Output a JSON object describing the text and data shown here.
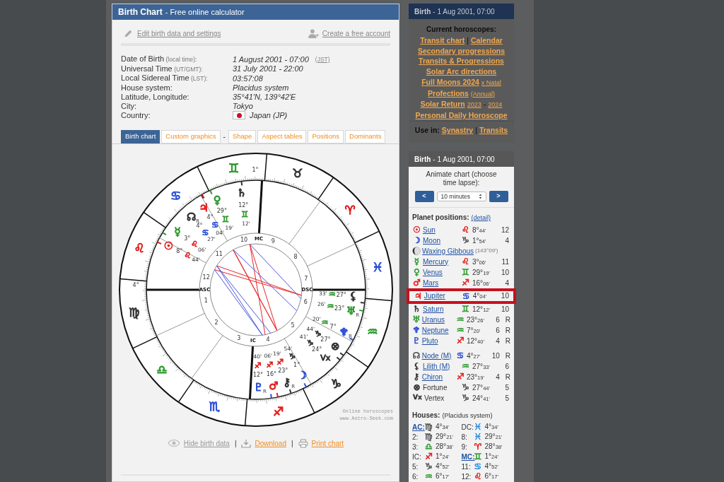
{
  "main_panel": {
    "title": "Birth Chart",
    "subtitle": "- Free online calculator",
    "edit_link": "Edit birth data and settings",
    "account_link": "Create a free account",
    "info": [
      {
        "label": "Date of Birth",
        "note": "(local time):",
        "value": "1 August 2001 - 07:00",
        "extra": "(JST)"
      },
      {
        "label": "Universal Time",
        "note": "(UT/GMT):",
        "value": "31 July 2001 - 22:00"
      },
      {
        "label": "Local Sidereal Time",
        "note": "(LST):",
        "value": "03:57:08"
      },
      {
        "label": "House system:",
        "value": "Placidus system"
      },
      {
        "label": "Latitude, Longitude:",
        "value": "35°41'N, 139°42'E"
      },
      {
        "label": "City:",
        "value": "Tokyo"
      },
      {
        "label": "Country:",
        "value": "Japan (JP)",
        "flag": true
      }
    ],
    "tabs": [
      {
        "kind": "tab",
        "label": "Birth chart",
        "selected": true
      },
      {
        "kind": "tab",
        "label": "Custom graphics",
        "selected": false
      },
      {
        "kind": "separator",
        "label": "-"
      },
      {
        "kind": "tab",
        "label": "Shape",
        "selected": false
      },
      {
        "kind": "tab",
        "label": "Aspect tables",
        "selected": false
      },
      {
        "kind": "tab",
        "label": "Positions",
        "selected": false
      },
      {
        "kind": "tab",
        "label": "Dominants",
        "selected": false
      }
    ],
    "chart": {
      "signs": [
        {
          "glyph": "♈︎",
          "color": "#e0201e"
        },
        {
          "glyph": "♉︎",
          "color": "#333333"
        },
        {
          "glyph": "♊︎",
          "color": "#2e9a2e"
        },
        {
          "glyph": "♋︎",
          "color": "#2c4fd6"
        },
        {
          "glyph": "♌︎",
          "color": "#e0201e"
        },
        {
          "glyph": "♍︎",
          "color": "#333333"
        },
        {
          "glyph": "♎︎",
          "color": "#2e9a2e"
        },
        {
          "glyph": "♏︎",
          "color": "#2c4fd6"
        },
        {
          "glyph": "♐︎",
          "color": "#e0201e"
        },
        {
          "glyph": "♑︎",
          "color": "#333333"
        },
        {
          "glyph": "♒︎",
          "color": "#2e9a2e"
        },
        {
          "glyph": "♓︎",
          "color": "#2c4fd6"
        }
      ],
      "houses": [
        "1",
        "2",
        "3",
        "4",
        "5",
        "6",
        "7",
        "8",
        "9",
        "10",
        "11",
        "12"
      ],
      "angles": [
        "ASC",
        "IC",
        "DSC",
        "MC"
      ],
      "angle_degrees": [
        "4°",
        "1°"
      ],
      "planets": [
        {
          "glyph": "☉",
          "color": "#e0201e",
          "degree": "8°",
          "sign": {
            "glyph": "♌︎",
            "color": "#e0201e"
          },
          "minute": "44'"
        },
        {
          "glyph": "☿",
          "color": "#2e9a2e",
          "degree": "3°",
          "sign": {
            "glyph": "♌︎",
            "color": "#e0201e"
          },
          "minute": "06'"
        },
        {
          "glyph": "☊",
          "color": "#333333",
          "retro": "R",
          "degree": "4°",
          "sign": {
            "glyph": "♋︎",
            "color": "#2c4fd6"
          },
          "minute": "27'"
        },
        {
          "glyph": "♃",
          "color": "#e0201e",
          "degree": "4°",
          "sign": {
            "glyph": "♋︎",
            "color": "#2c4fd6"
          },
          "minute": "04'"
        },
        {
          "glyph": "♀",
          "color": "#2e9a2e",
          "degree": "29°",
          "sign": {
            "glyph": "♊︎",
            "color": "#2e9a2e"
          },
          "minute": "19'"
        },
        {
          "glyph": "♄",
          "color": "#333333",
          "degree": "12°",
          "sign": {
            "glyph": "♊︎",
            "color": "#2e9a2e"
          },
          "minute": "12'"
        },
        {
          "glyph": "⚸",
          "color": "#333333",
          "degree": "27°",
          "sign": {
            "glyph": "♒︎",
            "color": "#2e9a2e"
          },
          "minute": "33'"
        },
        {
          "glyph": "♅",
          "color": "#2e9a2e",
          "retro": "R",
          "degree": "23°",
          "sign": {
            "glyph": "♒︎",
            "color": "#2e9a2e"
          },
          "minute": "26'"
        },
        {
          "glyph": "♆",
          "color": "#2c4fd6",
          "retro": "R",
          "degree": "7°",
          "sign": {
            "glyph": "♒︎",
            "color": "#2e9a2e"
          },
          "minute": "20'"
        },
        {
          "glyph": "⊗",
          "color": "#333333",
          "degree": "27°",
          "sign": {
            "glyph": "♑︎",
            "color": "#333333"
          },
          "minute": "44'"
        },
        {
          "glyph": "Vx",
          "color": "#333333",
          "degree": "24°",
          "sign": {
            "glyph": "♑︎",
            "color": "#333333"
          },
          "minute": "41'"
        },
        {
          "glyph": "☽",
          "color": "#2c4fd6",
          "degree": "1°",
          "sign": {
            "glyph": "♑︎",
            "color": "#333333"
          },
          "minute": "54'"
        },
        {
          "glyph": "⚷",
          "color": "#333333",
          "retro": "R",
          "degree": "23°",
          "sign": {
            "glyph": "♐︎",
            "color": "#e0201e"
          },
          "minute": "19'"
        },
        {
          "glyph": "♇",
          "color": "#2c4fd6",
          "retro": "R",
          "degree": "12°",
          "sign": {
            "glyph": "♐︎",
            "color": "#e0201e"
          },
          "minute": "40'"
        },
        {
          "glyph": "♂",
          "color": "#e0201e",
          "degree": "16°",
          "sign": {
            "glyph": "♐︎",
            "color": "#e0201e"
          },
          "minute": "06'"
        }
      ],
      "credit": [
        "Online horoscopes",
        "www.Astro-Seek.com"
      ]
    },
    "bottom_links": [
      {
        "kind": "hide",
        "label": "Hide birth data"
      },
      {
        "kind": "download",
        "label": "Download"
      },
      {
        "kind": "print",
        "label": "Print chart"
      }
    ],
    "bottom_separators": [
      "|",
      "|"
    ]
  },
  "horoscopes_panel": {
    "dimmed": true,
    "title": "Birth",
    "subtitle": "- 1 Aug 2001, 07:00",
    "heading": "Current horoscopes:",
    "lines": [
      [
        {
          "kind": "link",
          "text": "Transit chart"
        },
        {
          "kind": "text",
          "text": "|"
        },
        {
          "kind": "link",
          "text": "Calendar"
        }
      ],
      [
        {
          "kind": "link",
          "text": "Secondary progressions"
        }
      ],
      [
        {
          "kind": "link",
          "text": "Transits & Progressions"
        }
      ],
      [
        {
          "kind": "link",
          "text": "Solar Arc directions"
        }
      ],
      [
        {
          "kind": "link",
          "text": "Full Moons 2024"
        },
        {
          "kind": "small-link",
          "text": "x Natal"
        }
      ],
      [
        {
          "kind": "link",
          "text": "Profections"
        },
        {
          "kind": "small-link",
          "text": "(Annual)"
        }
      ],
      [
        {
          "kind": "link",
          "text": "Solar Return"
        },
        {
          "kind": "small-link",
          "text": "2023"
        },
        {
          "kind": "text",
          "text": "-"
        },
        {
          "kind": "small-link",
          "text": "2024"
        }
      ],
      [
        {
          "kind": "link",
          "text": "Personal Daily Horoscope"
        }
      ]
    ],
    "footer": [
      {
        "kind": "label",
        "text": "Use in:"
      },
      {
        "kind": "link",
        "text": "Synastry"
      },
      {
        "kind": "text",
        "text": "|"
      },
      {
        "kind": "link",
        "text": "Transits"
      }
    ]
  },
  "positions_panel": {
    "title": "Birth",
    "subtitle": "- 1 Aug 2001, 07:00",
    "animate": "Animate chart (choose time lapse):",
    "prev": "<",
    "lapse": "10 minutes",
    "next": ">",
    "heading": "Planet positions:",
    "detail": "(detail)",
    "planets": [
      {
        "kind": "planet",
        "glyph": "☉",
        "color": "#e0201e",
        "name": "Sun",
        "link": true,
        "sign": {
          "glyph": "♌︎",
          "color": "#e0201e"
        },
        "deg": "8°",
        "min": "44'",
        "house": "12",
        "highlighted": false
      },
      {
        "kind": "planet",
        "glyph": "☽",
        "color": "#2c4fd6",
        "name": "Moon",
        "link": true,
        "sign": {
          "glyph": "♑︎",
          "color": "#555555"
        },
        "deg": "1°",
        "min": "54'",
        "house": "4",
        "highlighted": false
      },
      {
        "kind": "phase",
        "name": "Waxing Gibbous",
        "link": true,
        "note": "(143°09')",
        "highlighted": false
      },
      {
        "kind": "planet",
        "glyph": "☿",
        "color": "#2e9a2e",
        "name": "Mercury",
        "link": true,
        "sign": {
          "glyph": "♌︎",
          "color": "#e0201e"
        },
        "deg": "3°",
        "min": "06'",
        "house": "11",
        "highlighted": false
      },
      {
        "kind": "planet",
        "glyph": "♀",
        "color": "#2e9a2e",
        "name": "Venus",
        "link": true,
        "sign": {
          "glyph": "♊︎",
          "color": "#2e9a2e"
        },
        "deg": "29°",
        "min": "19'",
        "house": "10",
        "highlighted": false
      },
      {
        "kind": "planet",
        "glyph": "♂",
        "color": "#e0201e",
        "name": "Mars",
        "link": true,
        "sign": {
          "glyph": "♐︎",
          "color": "#e0201e"
        },
        "deg": "16°",
        "min": "06'",
        "house": "4",
        "highlighted": false
      },
      {
        "kind": "planet",
        "glyph": "♃",
        "color": "#e0201e",
        "name": "Jupiter",
        "link": true,
        "sign": {
          "glyph": "♋︎",
          "color": "#2c4fd6"
        },
        "deg": "4°",
        "min": "04'",
        "house": "10",
        "highlighted": true
      },
      {
        "kind": "planet",
        "glyph": "♄",
        "color": "#333333",
        "name": "Saturn",
        "link": true,
        "sign": {
          "glyph": "♊︎",
          "color": "#2e9a2e"
        },
        "deg": "12°",
        "min": "12'",
        "house": "10",
        "highlighted": false
      },
      {
        "kind": "planet",
        "glyph": "♅",
        "color": "#2e9a2e",
        "name": "Uranus",
        "link": true,
        "sign": {
          "glyph": "♒︎",
          "color": "#2e9a2e"
        },
        "deg": "23°",
        "min": "26'",
        "house": "6",
        "retro": "R",
        "highlighted": false
      },
      {
        "kind": "planet",
        "glyph": "♆",
        "color": "#2c4fd6",
        "name": "Neptune",
        "link": true,
        "sign": {
          "glyph": "♒︎",
          "color": "#2e9a2e"
        },
        "deg": "7°",
        "min": "20'",
        "house": "6",
        "retro": "R",
        "highlighted": false
      },
      {
        "kind": "planet",
        "glyph": "♇",
        "color": "#2c4fd6",
        "name": "Pluto",
        "link": true,
        "sign": {
          "glyph": "♐︎",
          "color": "#e0201e"
        },
        "deg": "12°",
        "min": "40'",
        "house": "4",
        "retro": "R",
        "highlighted": false
      }
    ],
    "points": [
      {
        "kind": "planet",
        "glyph": "☊",
        "color": "#555555",
        "name": "Node (M)",
        "link": true,
        "sign": {
          "glyph": "♋︎",
          "color": "#2c4fd6"
        },
        "deg": "4°",
        "min": "27'",
        "house": "10",
        "retro": "R",
        "highlighted": false
      },
      {
        "kind": "planet",
        "glyph": "⚸",
        "color": "#333333",
        "name": "Lilith (M)",
        "link": true,
        "sign": {
          "glyph": "♒︎",
          "color": "#2e9a2e"
        },
        "deg": "27°",
        "min": "33'",
        "house": "6",
        "highlighted": false
      },
      {
        "kind": "planet",
        "glyph": "⚷",
        "color": "#333333",
        "name": "Chiron",
        "link": true,
        "sign": {
          "glyph": "♐︎",
          "color": "#e0201e"
        },
        "deg": "23°",
        "min": "19'",
        "house": "4",
        "retro": "R",
        "highlighted": false
      },
      {
        "kind": "planet",
        "glyph": "⊗",
        "color": "#333333",
        "name": "Fortune",
        "link": false,
        "sign": {
          "glyph": "♑︎",
          "color": "#555555"
        },
        "deg": "27°",
        "min": "44'",
        "house": "5",
        "highlighted": false
      },
      {
        "kind": "planet",
        "glyph": "Vx",
        "color": "#333333",
        "name": "Vertex",
        "link": false,
        "sign": {
          "glyph": "♑︎",
          "color": "#555555"
        },
        "deg": "24°",
        "min": "41'",
        "house": "5",
        "highlighted": false
      }
    ],
    "houses_heading": "Houses:",
    "houses_note": "(Placidus system)",
    "houses": [
      {
        "label": "AC:",
        "link": true,
        "sign": {
          "glyph": "♍︎",
          "color": "#555555"
        },
        "deg": "4°",
        "min": "34'"
      },
      {
        "label": "DC:",
        "link": false,
        "sign": {
          "glyph": "♓︎",
          "color": "#2c8fe0"
        },
        "deg": "4°",
        "min": "34'"
      },
      {
        "label": "2:",
        "link": false,
        "sign": {
          "glyph": "♍︎",
          "color": "#555555"
        },
        "deg": "29°",
        "min": "21'"
      },
      {
        "label": "8:",
        "link": false,
        "sign": {
          "glyph": "♓︎",
          "color": "#2c8fe0"
        },
        "deg": "29°",
        "min": "21'"
      },
      {
        "label": "3:",
        "link": false,
        "sign": {
          "glyph": "♎︎",
          "color": "#2e9a2e"
        },
        "deg": "28°",
        "min": "38'"
      },
      {
        "label": "9:",
        "link": false,
        "sign": {
          "glyph": "♈︎",
          "color": "#e0201e"
        },
        "deg": "28°",
        "min": "38'"
      },
      {
        "label": "IC:",
        "link": false,
        "sign": {
          "glyph": "♐︎",
          "color": "#e0201e"
        },
        "deg": "1°",
        "min": "24'"
      },
      {
        "label": "MC:",
        "link": true,
        "sign": {
          "glyph": "♊︎",
          "color": "#2e9a2e"
        },
        "deg": "1°",
        "min": "24'"
      },
      {
        "label": "5:",
        "link": false,
        "sign": {
          "glyph": "♑︎",
          "color": "#555555"
        },
        "deg": "4°",
        "min": "52'"
      },
      {
        "label": "11:",
        "link": false,
        "sign": {
          "glyph": "♋︎",
          "color": "#2c8fe0"
        },
        "deg": "4°",
        "min": "52'"
      },
      {
        "label": "6:",
        "link": false,
        "sign": {
          "glyph": "♒︎",
          "color": "#2e9a2e"
        },
        "deg": "6°",
        "min": "17'"
      },
      {
        "label": "12:",
        "link": false,
        "sign": {
          "glyph": "♌︎",
          "color": "#e0201e"
        },
        "deg": "6°",
        "min": "17'"
      }
    ]
  }
}
